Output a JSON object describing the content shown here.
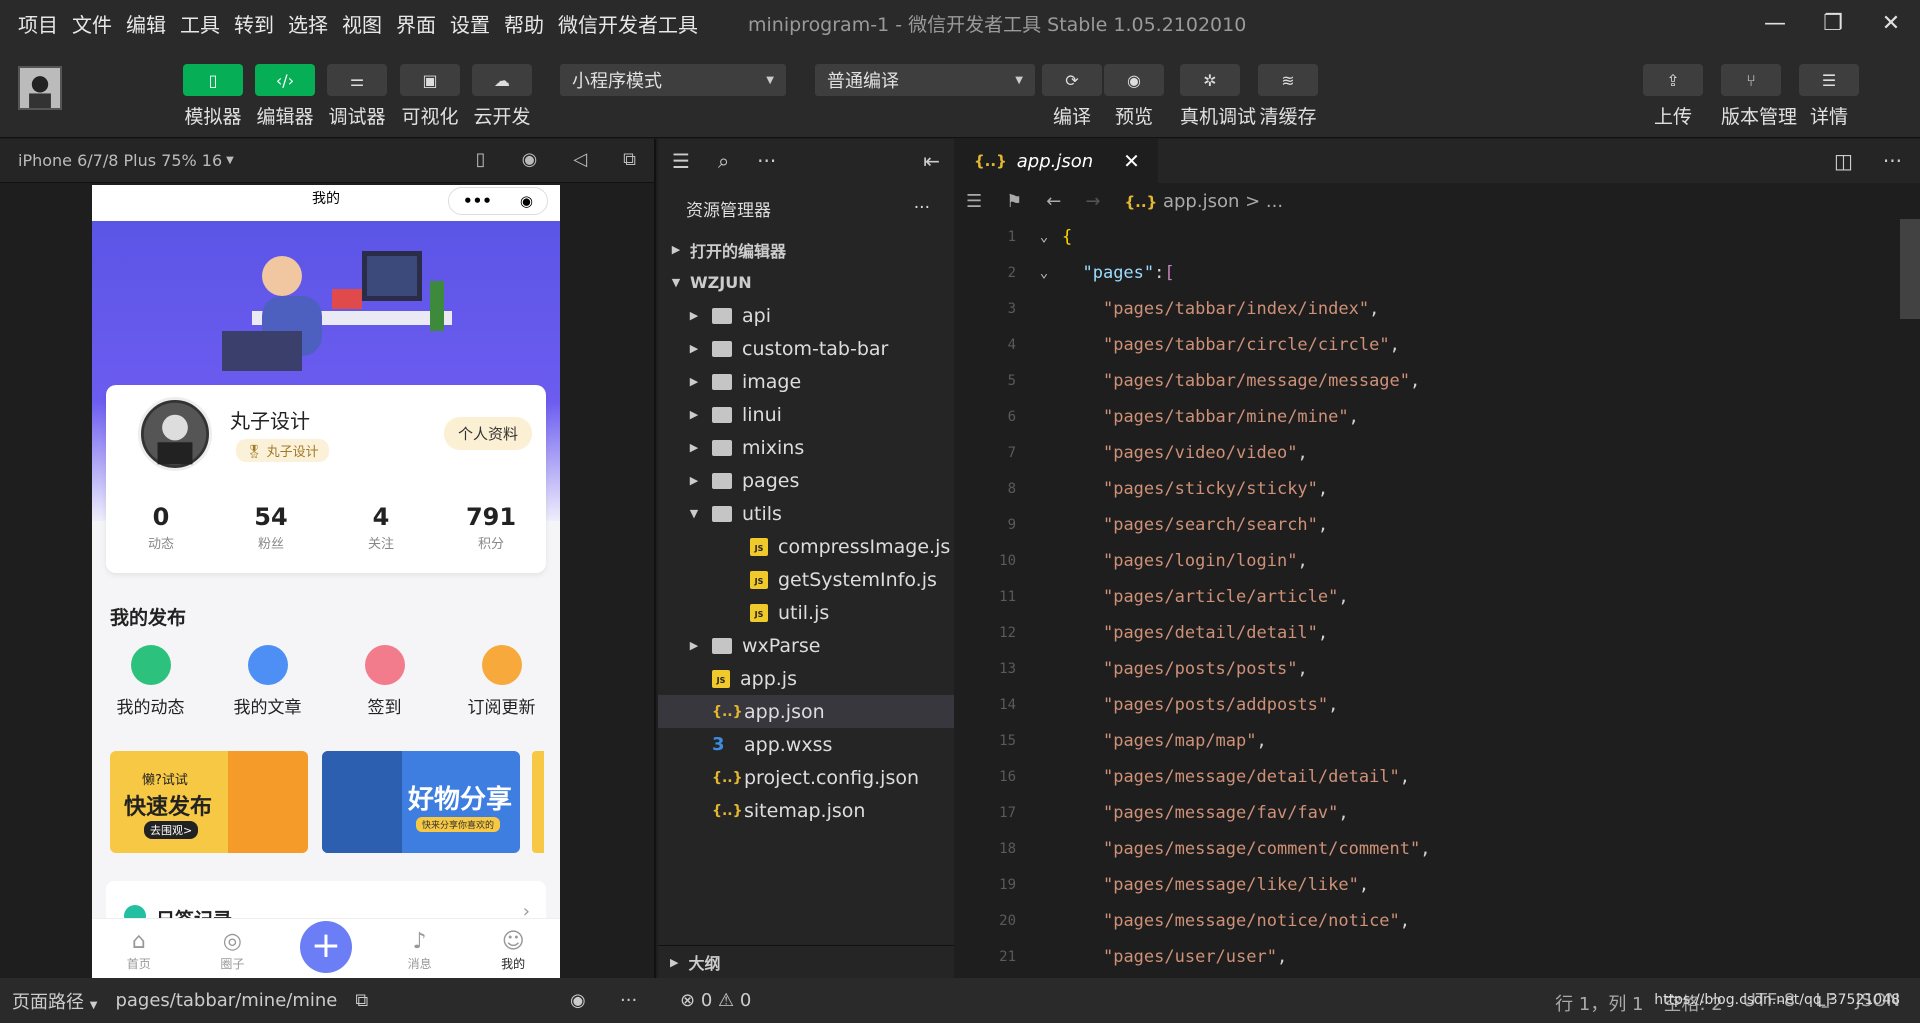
{
  "menubar": {
    "items": [
      "项目",
      "文件",
      "编辑",
      "工具",
      "转到",
      "选择",
      "视图",
      "界面",
      "设置",
      "帮助",
      "微信开发者工具"
    ],
    "title": "miniprogram-1 - 微信开发者工具 Stable 1.05.2102010"
  },
  "toolbar": {
    "buttons": [
      {
        "label": "模拟器",
        "icon": "phone-icon"
      },
      {
        "label": "编辑器",
        "icon": "code-icon"
      },
      {
        "label": "调试器",
        "icon": "sliders-icon"
      },
      {
        "label": "可视化",
        "icon": "layout-icon"
      },
      {
        "label": "云开发",
        "icon": "cloud-icon"
      }
    ],
    "mode_select": "小程序模式",
    "compile_select": "普通编译",
    "actions": [
      "编译",
      "预览",
      "真机调试",
      "清缓存"
    ],
    "right_actions": [
      "上传",
      "版本管理",
      "详情"
    ]
  },
  "simulator": {
    "device": "iPhone 6/7/8 Plus 75% 16",
    "nav_title": "我的",
    "capsule_dots": "•••",
    "user_name": "丸子设计",
    "badge": "丸子设计",
    "profile_button": "个人资料",
    "stats": [
      {
        "num": "0",
        "label": "动态"
      },
      {
        "num": "54",
        "label": "粉丝"
      },
      {
        "num": "4",
        "label": "关注"
      },
      {
        "num": "791",
        "label": "积分"
      }
    ],
    "section_title": "我的发布",
    "quick": [
      {
        "label": "我的动态",
        "color": "#2cc27e"
      },
      {
        "label": "我的文章",
        "color": "#4d8ff5"
      },
      {
        "label": "签到",
        "color": "#f27b8c"
      },
      {
        "label": "订阅更新",
        "color": "#f7a93b"
      }
    ],
    "banner1": {
      "small": "懒?试试",
      "big": "快速发布",
      "btn": "去围观>"
    },
    "banner2": {
      "big": "好物分享",
      "small": "快来分享你喜欢的"
    },
    "diary": "日签记录",
    "tabs": [
      {
        "label": "首页",
        "icon": "home-icon"
      },
      {
        "label": "圈子",
        "icon": "circle-icon"
      },
      {
        "label": "消息",
        "icon": "bell-icon"
      },
      {
        "label": "我的",
        "icon": "user-icon"
      }
    ]
  },
  "explorer": {
    "title": "资源管理器",
    "open_editors": "打开的编辑器",
    "project": "WZJUN",
    "items": [
      {
        "name": "api",
        "type": "folder",
        "expand": "▶"
      },
      {
        "name": "custom-tab-bar",
        "type": "folder",
        "expand": "▶"
      },
      {
        "name": "image",
        "type": "folder",
        "expand": "▶"
      },
      {
        "name": "linui",
        "type": "folder",
        "expand": "▶"
      },
      {
        "name": "mixins",
        "type": "folder",
        "expand": "▶"
      },
      {
        "name": "pages",
        "type": "folder",
        "expand": "▶"
      },
      {
        "name": "utils",
        "type": "folder",
        "expand": "▼"
      },
      {
        "name": "compressImage.js",
        "type": "js",
        "expand": ""
      },
      {
        "name": "getSystemInfo.js",
        "type": "js",
        "expand": ""
      },
      {
        "name": "util.js",
        "type": "js",
        "expand": ""
      },
      {
        "name": "wxParse",
        "type": "folder",
        "expand": "▶"
      },
      {
        "name": "app.js",
        "type": "js",
        "expand": ""
      },
      {
        "name": "app.json",
        "type": "json",
        "expand": ""
      },
      {
        "name": "app.wxss",
        "type": "css",
        "expand": ""
      },
      {
        "name": "project.config.json",
        "type": "json",
        "expand": ""
      },
      {
        "name": "sitemap.json",
        "type": "json",
        "expand": ""
      }
    ],
    "outline": "大纲"
  },
  "editor": {
    "tab": "app.json",
    "breadcrumb": "app.json > ...",
    "key": "\"pages\"",
    "lines": [
      "pages/tabbar/index/index",
      "pages/tabbar/circle/circle",
      "pages/tabbar/message/message",
      "pages/tabbar/mine/mine",
      "pages/video/video",
      "pages/sticky/sticky",
      "pages/search/search",
      "pages/login/login",
      "pages/article/article",
      "pages/detail/detail",
      "pages/posts/posts",
      "pages/posts/addposts",
      "pages/map/map",
      "pages/message/detail/detail",
      "pages/message/fav/fav",
      "pages/message/comment/comment",
      "pages/message/like/like",
      "pages/message/notice/notice",
      "pages/user/user"
    ]
  },
  "status": {
    "path_label": "页面路径",
    "path": "pages/tabbar/mine/mine",
    "errors": "0",
    "warnings": "0",
    "position": "行 1，列 1",
    "spaces": "空格: 2",
    "encoding": "UTF-8",
    "eol": "LF",
    "lang": "JSON",
    "watermark": "https://blog.csdn.net/qq_37521048"
  }
}
